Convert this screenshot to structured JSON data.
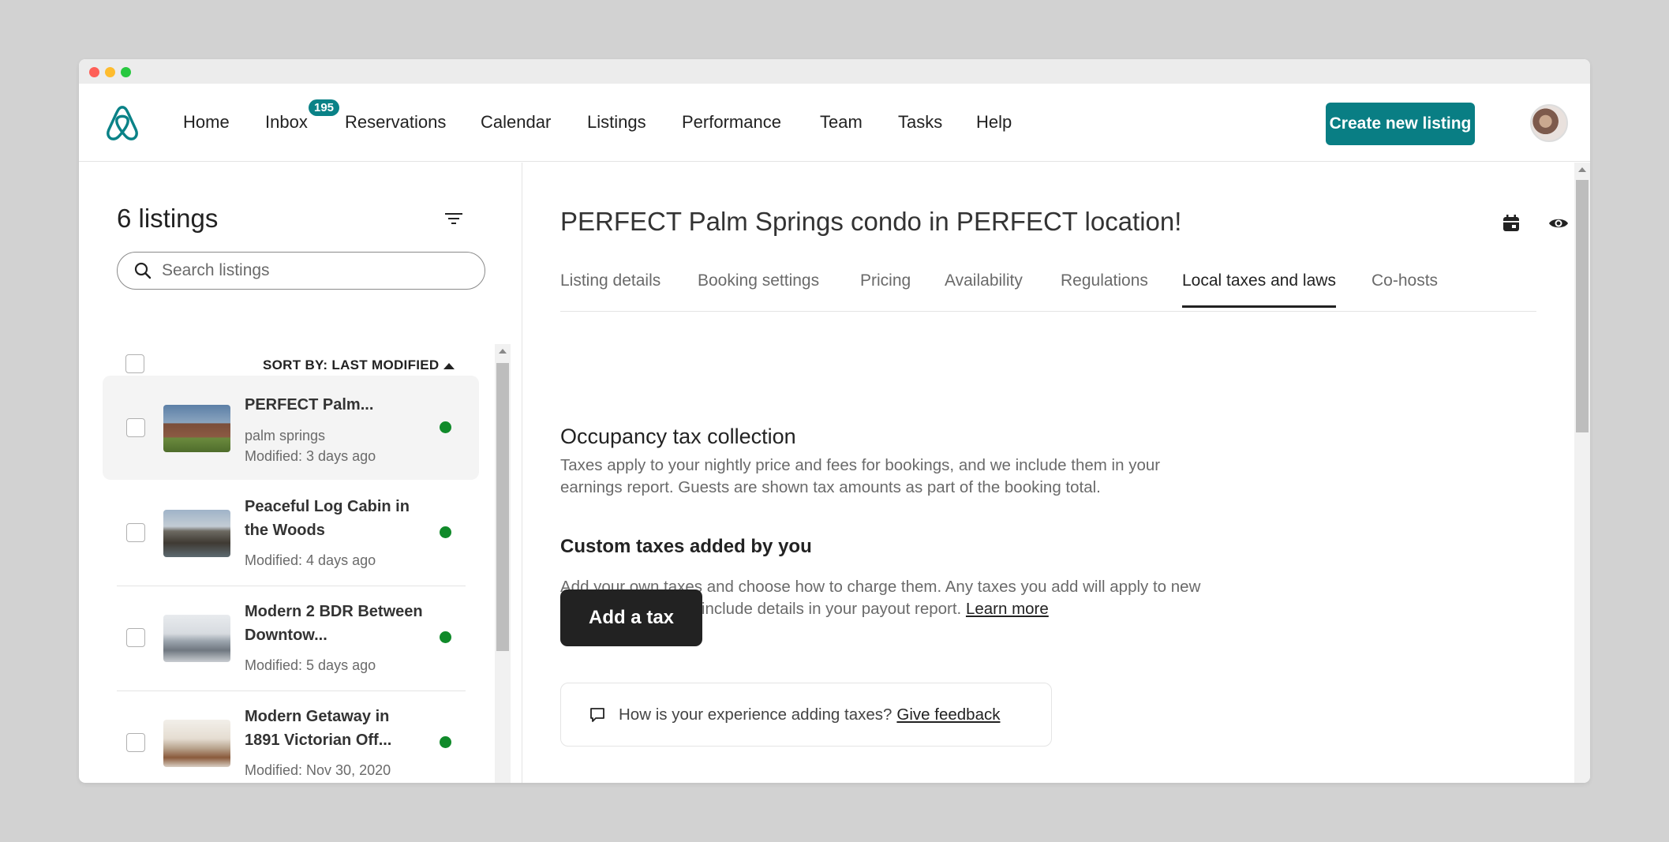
{
  "nav": {
    "items": [
      "Home",
      "Inbox",
      "Reservations",
      "Calendar",
      "Listings",
      "Performance",
      "Team",
      "Tasks",
      "Help"
    ],
    "inbox_badge": "195",
    "create_label": "Create new listing",
    "accent_color": "#097e84"
  },
  "sidebar": {
    "title": "6 listings",
    "search_placeholder": "Search listings",
    "sort_label": "SORT BY: LAST MODIFIED",
    "listings": [
      {
        "title": "PERFECT Palm...",
        "location": "palm springs",
        "modified": "Modified: 3 days ago",
        "status_color": "#108a2a"
      },
      {
        "title": "Peaceful Log Cabin in the Woods",
        "modified": "Modified: 4 days ago",
        "status_color": "#108a2a"
      },
      {
        "title": "Modern 2 BDR Between Downtow...",
        "modified": "Modified: 5 days ago",
        "status_color": "#108a2a"
      },
      {
        "title": "Modern Getaway in 1891 Victorian Off...",
        "modified": "Modified: Nov 30, 2020",
        "status_color": "#108a2a"
      }
    ]
  },
  "main": {
    "title": "PERFECT Palm Springs condo in PERFECT location!",
    "tabs": [
      "Listing details",
      "Booking settings",
      "Pricing",
      "Availability",
      "Regulations",
      "Local taxes and laws",
      "Co-hosts"
    ],
    "active_tab": "Local taxes and laws",
    "occupancy_title": "Occupancy tax collection",
    "occupancy_text": "Taxes apply to your nightly price and fees for bookings, and we include them in your earnings report. Guests are shown tax amounts as part of the booking total.",
    "custom_title": "Custom taxes added by you",
    "custom_text": "Add your own taxes and choose how to charge them. Any taxes you add will apply to new bookings, and we’ll include details in your payout report.",
    "learn_more": "Learn more",
    "add_tax": "Add a tax",
    "feedback_text": "How is your experience adding taxes?",
    "feedback_link": "Give feedback"
  }
}
